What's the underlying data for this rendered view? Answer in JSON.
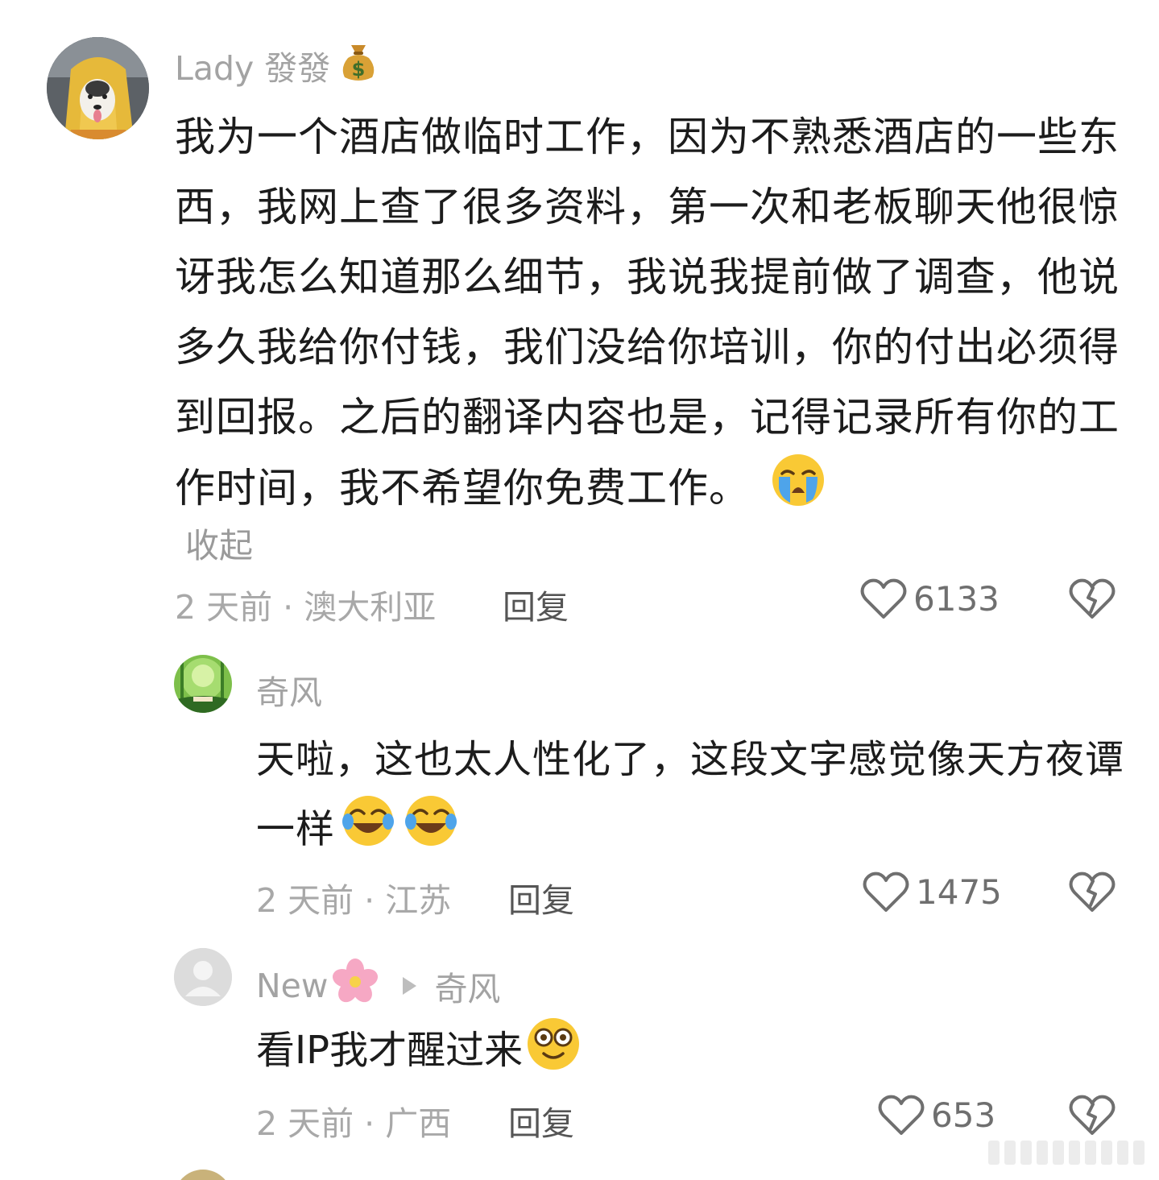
{
  "comments": [
    {
      "author": "Lady 發發",
      "author_emoji": "money-bag-icon",
      "text": "我为一个酒店做临时工作，因为不熟悉酒店的一些东西，我网上查了很多资料，第一次和老板聊天他很惊讶我怎么知道那么细节，我说我提前做了调查，他说多久我给你付钱，我们没给你培训，你的付出必须得到回报。之后的翻译内容也是，记得记录所有你的工作时间，我不希望你免费工作。",
      "text_emoji": "loudly-crying-face-icon",
      "collapse_label": "收起",
      "meta": "2 天前 · 澳大利亚",
      "reply_label": "回复",
      "likes": "6133"
    },
    {
      "author": "奇风",
      "text": "天啦，这也太人性化了，这段文字感觉像天方夜谭一样",
      "text_emoji": "face-with-tears-of-joy-icon",
      "meta": "2 天前 · 江苏",
      "reply_label": "回复",
      "likes": "1475"
    },
    {
      "author": "New",
      "author_emoji": "cherry-blossom-icon",
      "reply_to": "奇风",
      "text": "看IP我才醒过来",
      "text_emoji": "flushed-face-icon",
      "meta": "2 天前 · 广西",
      "reply_label": "回复",
      "likes": "653"
    }
  ],
  "colors": {
    "text": "#1c1c1c",
    "muted": "#a8a8a8",
    "reply": "#555555",
    "icon": "#6f6f6f"
  }
}
